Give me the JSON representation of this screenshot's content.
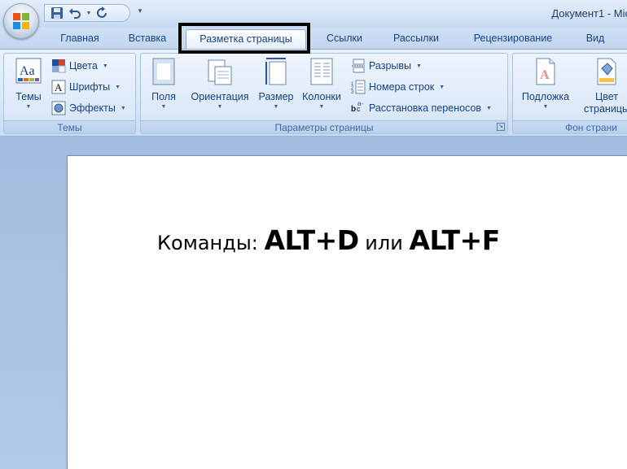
{
  "window": {
    "title": "Документ1 - Mic"
  },
  "tabs": [
    {
      "label": "Главная"
    },
    {
      "label": "Вставка"
    },
    {
      "label": "Разметка страницы"
    },
    {
      "label": "Ссылки"
    },
    {
      "label": "Рассылки"
    },
    {
      "label": "Рецензирование"
    },
    {
      "label": "Вид"
    }
  ],
  "ribbon": {
    "themes_group": {
      "label": "Темы",
      "themes_button": "Темы",
      "colors": "Цвета",
      "fonts": "Шрифты",
      "effects": "Эффекты"
    },
    "page_setup_group": {
      "label": "Параметры страницы",
      "margins": "Поля",
      "orientation": "Ориентация",
      "size": "Размер",
      "columns": "Колонки",
      "breaks": "Разрывы",
      "line_numbers": "Номера строк",
      "hyphenation": "Расстановка переносов"
    },
    "page_background_group": {
      "label": "Фон страни",
      "watermark": "Подложка",
      "page_color_line1": "Цвет",
      "page_color_line2": "страницы"
    }
  },
  "document": {
    "text_prefix": "Команды: ",
    "shortcut_1": "ALT+D",
    "text_middle": " или ",
    "shortcut_2": "ALT+F"
  }
}
